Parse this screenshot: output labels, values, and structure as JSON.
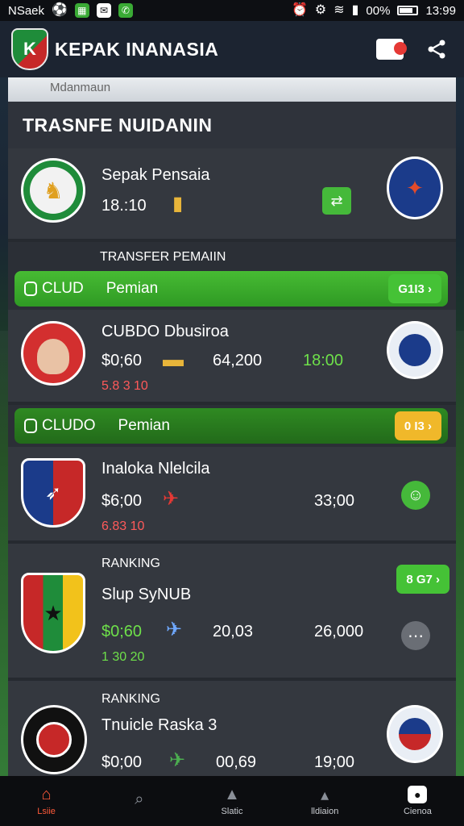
{
  "status_bar": {
    "carrier": "NSaek",
    "battery": "00%",
    "time": "13:99"
  },
  "app_bar": {
    "title": "KEPAK INANASIA",
    "logo_letter": "K"
  },
  "search": {
    "placeholder": "Mdanmaun"
  },
  "section": {
    "title": "TRASNFE NUIDANIN"
  },
  "rows": [
    {
      "name": "Sepak Pensaia",
      "value": "18.:10"
    },
    {
      "subheader": "TRANSFER PEMAIIN"
    },
    {
      "club": "CLUD",
      "label": "Pemian",
      "pill": "G1I3 ›"
    },
    {
      "name": "CUBDO Dbusiroa",
      "value": "$0;60",
      "value2": "64,200",
      "value3": "18:00",
      "sub": "5.8 3 10"
    },
    {
      "club": "CLUDO",
      "label": "Pemian",
      "pill": "0 I3 ›"
    },
    {
      "name": "Inaloka Nlelcila",
      "value": "$6;00",
      "value2": "33;00",
      "sub": "6.83 10"
    },
    {
      "header": "RANKING",
      "name": "Slup SyNUB",
      "value": "$0;60",
      "value2": "20,03",
      "value3": "26,000",
      "sub": "1 30 20",
      "pill": "8 G7 ›"
    },
    {
      "header": "RANKING",
      "name": "Tnuicle Raska 3",
      "value": "$0;00",
      "value2": "00,69",
      "value3": "19;00"
    }
  ],
  "nav": [
    {
      "label": "Lsiie",
      "icon": "home-icon"
    },
    {
      "label": "",
      "icon": "search-icon"
    },
    {
      "label": "Slatic",
      "icon": "chart-icon"
    },
    {
      "label": "lldiaion",
      "icon": "hat-icon"
    },
    {
      "label": "Cienoa",
      "icon": "app-icon"
    }
  ],
  "colors": {
    "accent_green": "#45c236",
    "accent_yellow": "#f0b82a",
    "active_nav": "#ff5a3a"
  }
}
